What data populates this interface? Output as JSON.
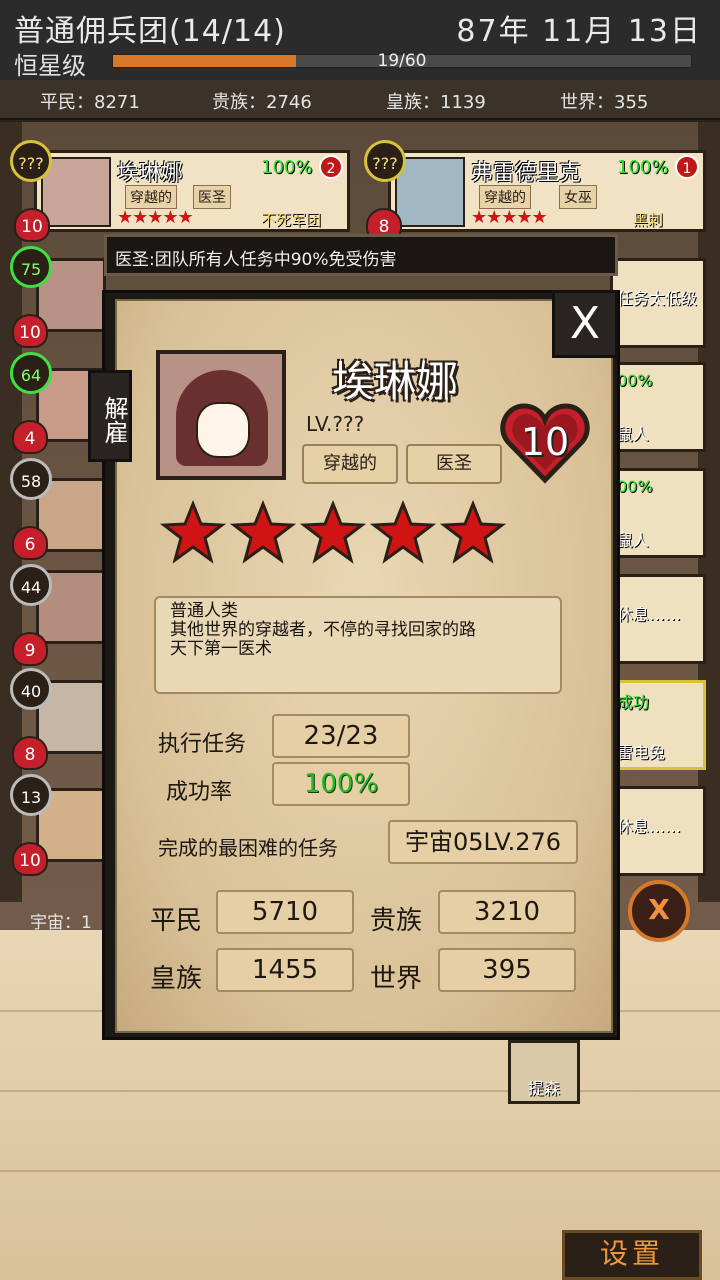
{
  "header": {
    "title": "普通佣兵团(14/14)",
    "date": "87年 11月 13日",
    "rank": "恒星级",
    "progress_text": "19/60",
    "progress": 0.3167
  },
  "stats": {
    "commoner": "平民：8271",
    "noble": "贵族：2746",
    "royal": "皇族：1139",
    "world": "世界：355"
  },
  "cards": {
    "ailina": {
      "name": "埃琳娜",
      "tag1": "穿越的",
      "tag2": "医圣",
      "pct": "100%",
      "badge": "2",
      "team": "不死军团",
      "level": "???",
      "hearts": "10",
      "stars": "★★★★★"
    },
    "frederick": {
      "name": "弗雷德里克",
      "tag1": "穿越的",
      "tag2": "女巫",
      "pct": "100%",
      "badge": "1",
      "team": "黑刺",
      "level": "???",
      "hearts": "8",
      "stars": "★★★★★"
    }
  },
  "side_levels": [
    {
      "level": "75",
      "hearts": "10"
    },
    {
      "level": "64",
      "hearts": "4"
    },
    {
      "level": "58",
      "hearts": "6"
    },
    {
      "level": "44",
      "hearts": "9"
    },
    {
      "level": "40",
      "hearts": "8"
    },
    {
      "level": "13",
      "hearts": "10"
    }
  ],
  "right_cards": [
    {
      "top": "",
      "bottom": "任务太低级"
    },
    {
      "top": "00%",
      "bottom": "鼠人"
    },
    {
      "top": "00%",
      "bottom": "鼠人"
    },
    {
      "top": "",
      "bottom": "休息……"
    },
    {
      "top": "成功",
      "bottom": "雷电兔"
    },
    {
      "top": "",
      "bottom": "休息……"
    }
  ],
  "tooltip": "医圣:团队所有人任务中90%免受伤害",
  "modal": {
    "close": "X",
    "dismiss": "解雇",
    "name": "埃琳娜",
    "level": "LV.???",
    "tag1": "穿越的",
    "tag2": "医圣",
    "hearts": "10",
    "stars": 5,
    "description": [
      "普通人类",
      "其他世界的穿越者，不停的寻找回家的路",
      "天下第一医术"
    ],
    "missions_label": "执行任务",
    "missions_value": "23/23",
    "success_label": "成功率",
    "success_value": "100%",
    "hardest_label": "完成的最困难的任务",
    "hardest_value": "宇宙05LV.276",
    "commoner_label": "平民",
    "commoner_value": "5710",
    "noble_label": "贵族",
    "noble_value": "3210",
    "royal_label": "皇族",
    "royal_value": "1455",
    "world_label": "世界",
    "world_value": "395"
  },
  "bottom": {
    "cosmos_label": "宇宙：1",
    "emblem": "X",
    "tison": "提森",
    "settings": "设置"
  },
  "colors": {
    "accent_orange": "#d7782b",
    "success_green": "#1fc01f",
    "star_red": "#d01414"
  }
}
